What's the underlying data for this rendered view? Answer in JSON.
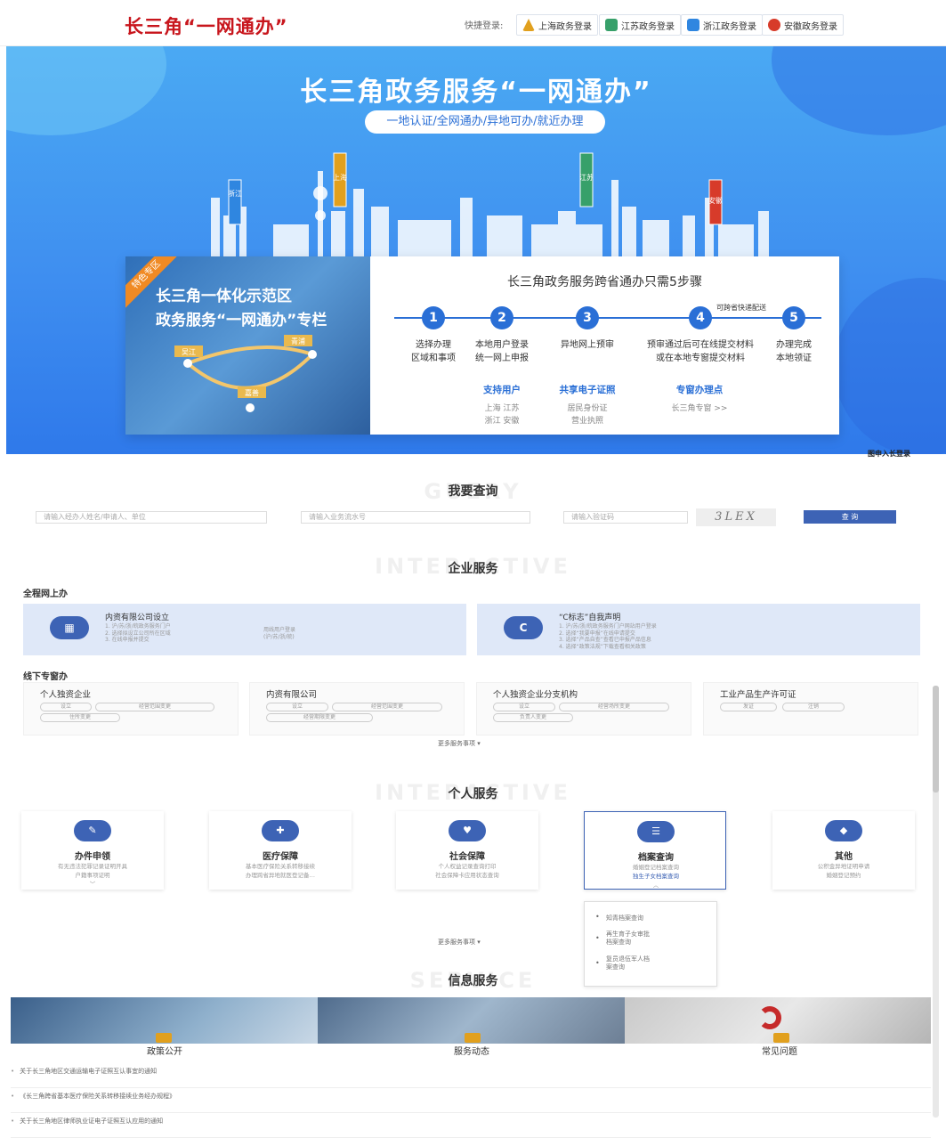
{
  "header": {
    "logo": "长三角“一网通办”",
    "quick_label": "快捷登录:",
    "logins": [
      {
        "label": "上海政务登录",
        "icon": "shanghai-icon",
        "color": "#e1a01e"
      },
      {
        "label": "江苏政务登录",
        "icon": "jiangsu-icon",
        "color": "#37a06a"
      },
      {
        "label": "浙江政务登录",
        "icon": "zhejiang-icon",
        "color": "#2f86e0"
      },
      {
        "label": "安徽政务登录",
        "icon": "anhui-icon",
        "color": "#d73b2a"
      }
    ]
  },
  "hero": {
    "title": "长三角政务服务“一网通办”",
    "subtitle": "一地认证/全网通办/异地可办/就近办理",
    "city_labels": [
      "浙江",
      "上海",
      "江苏",
      "安徽"
    ]
  },
  "feature": {
    "ribbon": "特色专区",
    "line1": "长三角一体化示范区",
    "line2": "政务服务“一网通办”专栏",
    "map_labels": [
      "吴江",
      "青浦",
      "嘉善"
    ],
    "steps_title": "长三角政务服务跨省通办只需5步骤",
    "express_note": "可跨省快递配送",
    "steps": [
      {
        "num": "1",
        "line1": "选择办理",
        "line2": "区域和事项"
      },
      {
        "num": "2",
        "line1": "本地用户登录",
        "line2": "统一网上申报"
      },
      {
        "num": "3",
        "line1": "异地网上预审",
        "line2": ""
      },
      {
        "num": "4",
        "line1": "预审通过后可在线提交材料",
        "line2": "或在本地专窗提交材料"
      },
      {
        "num": "5",
        "line1": "办理完成",
        "line2": "本地领证"
      }
    ],
    "info": [
      {
        "heading": "支持用户",
        "line1": "上海  江苏",
        "line2": "浙江  安徽"
      },
      {
        "heading": "共享电子证照",
        "line1": "居民身份证",
        "line2": "营业执照"
      },
      {
        "heading": "专窗办理点",
        "line1": "长三角专窗 >>",
        "line2": ""
      }
    ]
  },
  "side_link": "图申入长登录",
  "query": {
    "ghost": "GUERY",
    "title": "我要查询",
    "inputs": [
      "请输入经办人姓名/申请人、单位",
      "请输入业务流水号",
      "请输入验证码"
    ],
    "captcha": "3LEX",
    "button": "查 询"
  },
  "enterprise": {
    "ghost": "INTERACTIVE",
    "title": "企业服务",
    "online_heading": "全程网上办",
    "online_cards": [
      {
        "icon_text": "▦",
        "title": "内资有限公司设立",
        "desc": [
          "1. 沪/苏/浙/皖政务服务门户",
          "2. 选择拟设立公司所在区域",
          "3. 在线申报并提交"
        ],
        "desc2": [
          "用线用户登录",
          "(沪/苏/浙/皖)"
        ]
      },
      {
        "icon_text": "C",
        "title": "“C标志”自我声明",
        "desc": [
          "1. 沪/苏/浙/皖政务服务门户网站用户登录",
          "2. 选择“我要申报”在线申请提交",
          "3. 选择“产品自查”查看已申报产品信息",
          "4. 选择“政策法规”下载查看相关政策"
        ],
        "desc2": []
      }
    ],
    "offline_heading": "线下专窗办",
    "offline_cards": [
      {
        "title": "个人独资企业",
        "tags": [
          "设立",
          "经营范围变更",
          "住所变更"
        ]
      },
      {
        "title": "内资有限公司",
        "tags": [
          "设立",
          "经营范围变更",
          "经营期限变更"
        ]
      },
      {
        "title": "个人独资企业分支机构",
        "tags": [
          "设立",
          "经营场所变更",
          "负责人变更"
        ]
      },
      {
        "title": "工业产品生产许可证",
        "tags": [
          "发证",
          "注销"
        ]
      }
    ],
    "more": "更多服务事项 ▾"
  },
  "personal": {
    "ghost": "INTERACTIVE",
    "title": "个人服务",
    "cards": [
      {
        "icon": "pen-icon",
        "icon_text": "✎",
        "title": "办件申领",
        "desc1": "有无违法犯罪记录证明开具",
        "desc2": "户籍事项证明",
        "chev": "﹀"
      },
      {
        "icon": "medical-icon",
        "icon_text": "✚",
        "title": "医疗保障",
        "desc1": "基本医疗保险关系转移接续",
        "desc2": "办理跨省异地就医登记备…",
        "chev": ""
      },
      {
        "icon": "handshake-icon",
        "icon_text": "♥",
        "title": "社会保障",
        "desc1": "个人权益记录查询打印",
        "desc2": "社会保障卡应用状态查询",
        "chev": ""
      },
      {
        "icon": "document-icon",
        "icon_text": "☰",
        "title": "档案查询",
        "desc1": "婚姻登记档案查询",
        "desc2": "独生子女档案查询",
        "chev": "︿"
      },
      {
        "icon": "layers-icon",
        "icon_text": "◆",
        "title": "其他",
        "desc1": "公积金异地证明申请",
        "desc2": "婚姻登记预约",
        "chev": ""
      }
    ],
    "dropdown": [
      {
        "line1": "知青档案查询",
        "line2": ""
      },
      {
        "line1": "再生育子女审批",
        "line2": "档案查询"
      },
      {
        "line1": "复员退伍军人档",
        "line2": "案查询"
      }
    ],
    "more": "更多服务事项 ▾"
  },
  "info_service": {
    "ghost": "SERVICE",
    "title": "信息服务",
    "tabs": [
      "政策公开",
      "服务动态",
      "常见问题"
    ],
    "news": [
      "关于长三角地区交通运输电子证照互认事宜的通知",
      "《长三角跨省基本医疗保险关系转移接续业务经办规程》",
      "关于长三角地区律师执业证电子证照互认应用的通知"
    ]
  },
  "colors": {
    "brand_red": "#c8161d",
    "primary_blue": "#2a6fd6",
    "button_blue": "#3d63b5",
    "hero_blue": "#3f8ff0"
  }
}
